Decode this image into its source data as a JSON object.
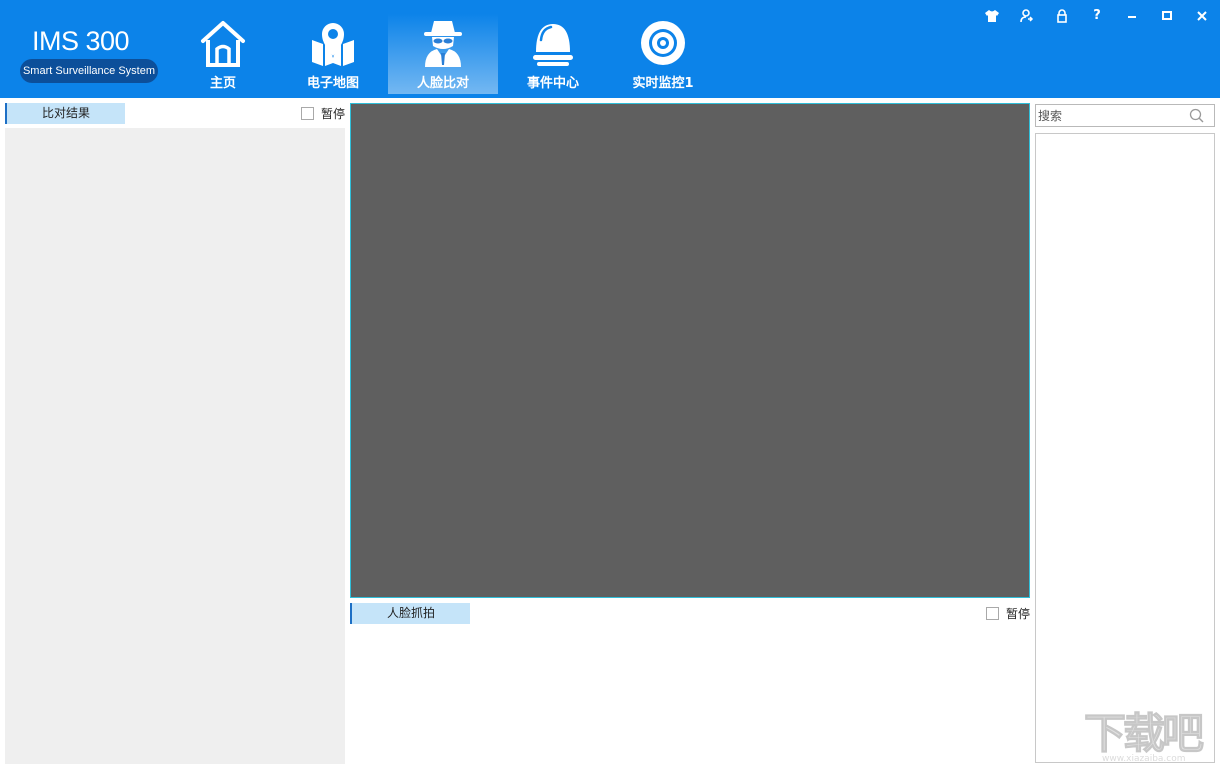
{
  "app": {
    "logo_title": "IMS 300",
    "logo_subtitle": "Smart Surveillance System"
  },
  "nav": {
    "home": "主页",
    "emap": "电子地图",
    "face_compare": "人脸比对",
    "event_center": "事件中心",
    "live_monitor": "实时监控1",
    "active": "face_compare"
  },
  "window_controls": {
    "help_label": "?"
  },
  "left_panel": {
    "tab_label": "比对结果",
    "pause_label": "暂停"
  },
  "capture_panel": {
    "tab_label": "人脸抓拍",
    "pause_label": "暂停"
  },
  "right_panel": {
    "search_placeholder": "搜索"
  },
  "watermark": {
    "main": "下载吧",
    "url": "www.xiazaiba.com"
  },
  "colors": {
    "header": "#0c83e9",
    "video_bg": "#5f5f5f",
    "tab_bg": "#c5e4f9",
    "accent": "#1d6fc5"
  },
  "icons": [
    "home-icon",
    "map-pin-icon",
    "spy-face-icon",
    "alarm-light-icon",
    "camera-icon",
    "skin-icon",
    "user-switch-icon",
    "lock-icon",
    "help-icon",
    "minimize-icon",
    "maximize-icon",
    "close-icon",
    "search-icon"
  ]
}
